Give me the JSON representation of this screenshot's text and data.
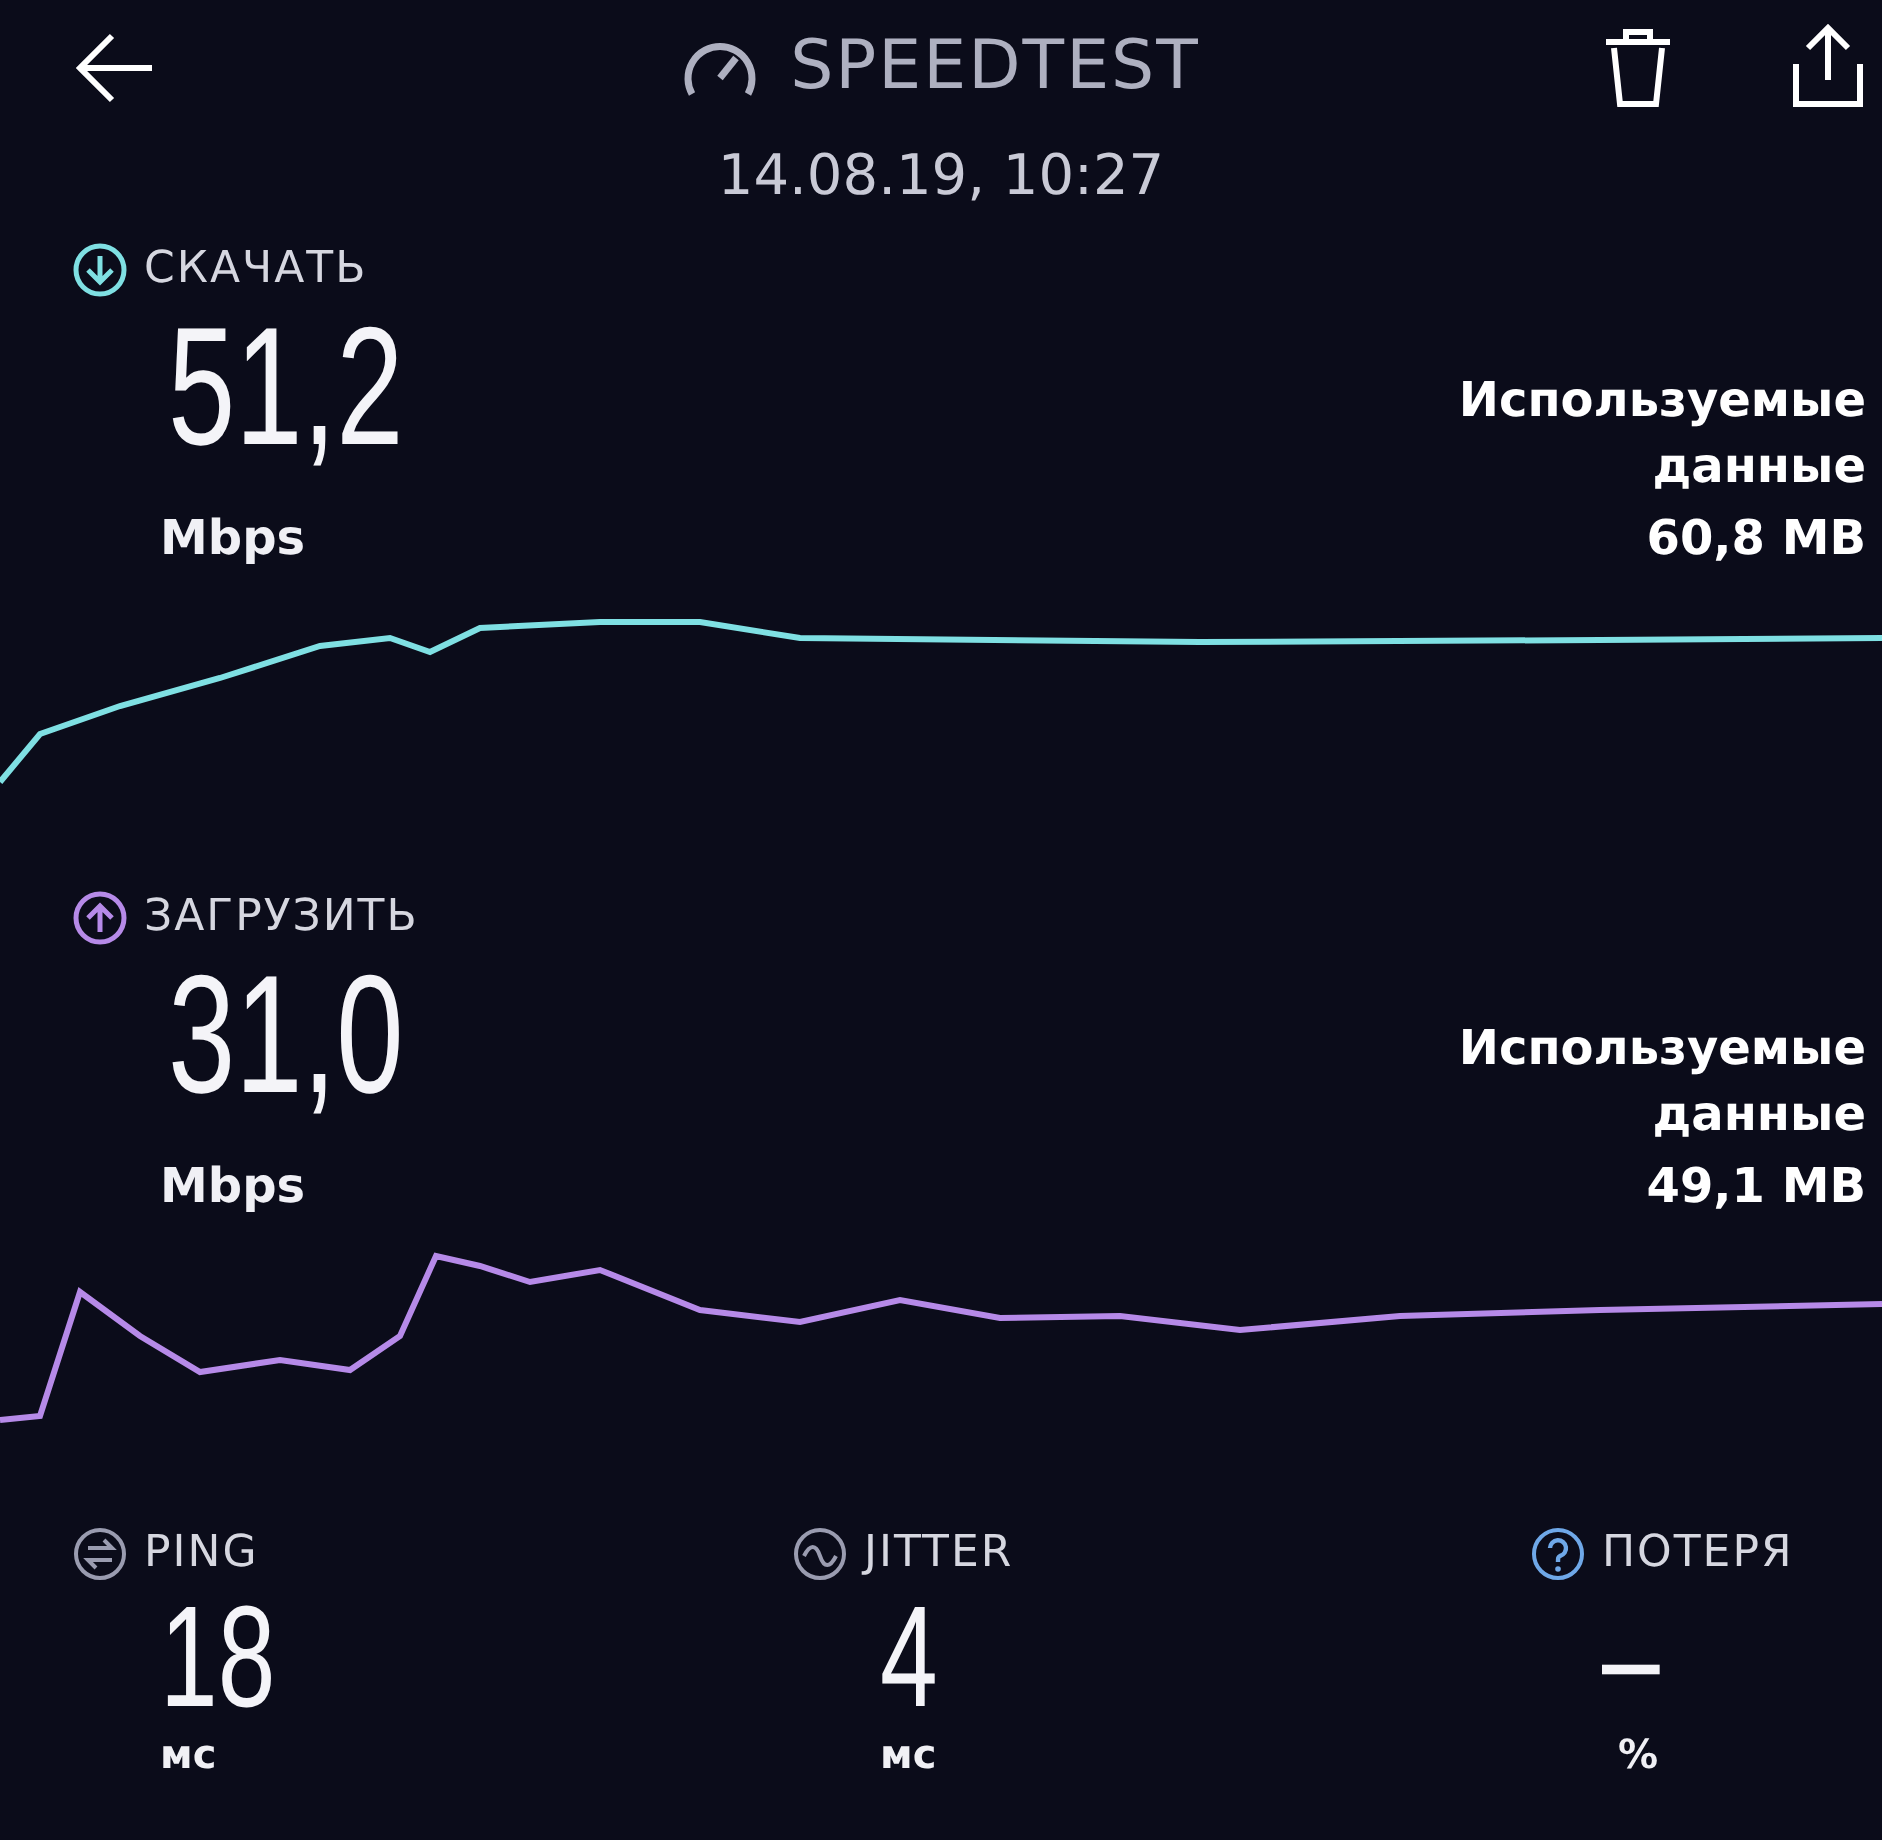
{
  "header": {
    "title": "SPEEDTEST",
    "date": "14.08.19, 10:27"
  },
  "tests": [
    {
      "kind": "download",
      "label": "СКАЧАТЬ",
      "value": "51,2",
      "unit": "Mbps",
      "data_label": "Используемые данные",
      "data_value": "60,8 MB",
      "color": "#7fe0e3"
    },
    {
      "kind": "upload",
      "label": "ЗАГРУЗИТЬ",
      "value": "31,0",
      "unit": "Mbps",
      "data_label": "Используемые данные",
      "data_value": "49,1 MB",
      "color": "#b68ae8"
    }
  ],
  "metrics": [
    {
      "kind": "ping",
      "label": "PING",
      "value": "18",
      "unit": "мс"
    },
    {
      "kind": "jitter",
      "label": "JITTER",
      "value": "4",
      "unit": "мс"
    },
    {
      "kind": "loss",
      "label": "ПОТЕРЯ",
      "value": "–",
      "unit": "%"
    }
  ]
}
